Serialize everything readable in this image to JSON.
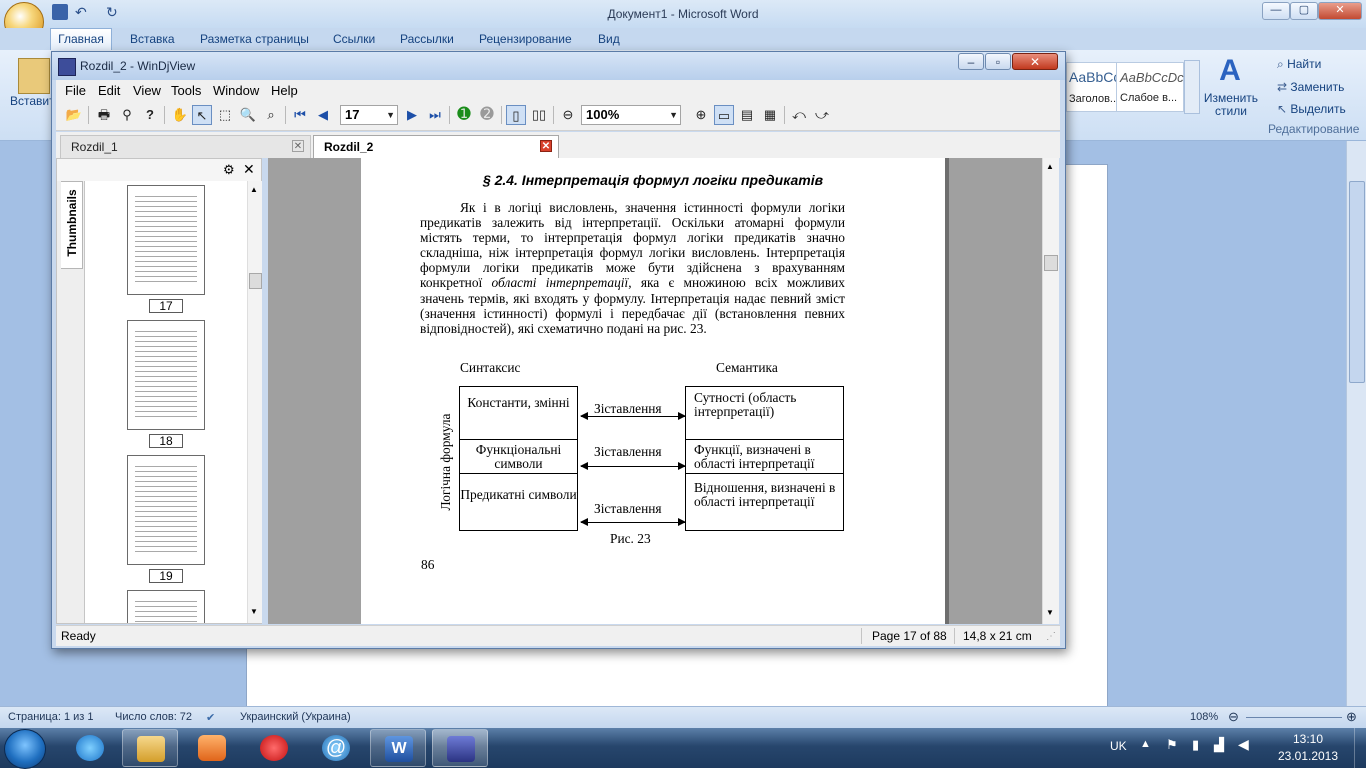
{
  "word": {
    "title": "Документ1 - Microsoft Word",
    "window_controls": [
      "—",
      "▢",
      "✕"
    ],
    "tabs": [
      "Главная",
      "Вставка",
      "Разметка страницы",
      "Ссылки",
      "Рассылки",
      "Рецензирование",
      "Вид"
    ],
    "ribbon": {
      "paste": "Вставит",
      "styles": [
        "AaBbCc.",
        "AaBbCcDc"
      ],
      "style_names": [
        "Заголов...",
        "Слабое в..."
      ],
      "change_styles": "Изменить стили",
      "find": "Найти",
      "replace": "Заменить",
      "select": "Выделить",
      "editing": "Редактирование"
    },
    "status": {
      "page": "Страница: 1 из 1",
      "words": "Число слов: 72",
      "language": "Украинский (Украина)",
      "zoom": "108%"
    }
  },
  "taskbar": {
    "language": "UK",
    "time": "13:10",
    "date": "23.01.2013"
  },
  "djvu": {
    "title": "Rozdil_2 - WinDjView",
    "menu": [
      "File",
      "Edit",
      "View",
      "Tools",
      "Window",
      "Help"
    ],
    "page_box": "17",
    "zoom_box": "100%",
    "tabs": [
      "Rozdil_1",
      "Rozdil_2"
    ],
    "sidebar_tab": "Thumbnails",
    "thumbnails": [
      "17",
      "18",
      "19"
    ],
    "status": {
      "left": "Ready",
      "page": "Page 17 of 88",
      "size": "14,8 x 21 cm"
    },
    "page": {
      "section_title": "§ 2.4. Інтерпретація формул логіки предикатів",
      "paragraph_before_italic": "Як і в логіці висловлень, значення істинності формули логіки предикатів залежить від інтерпретації. Оскільки атомарні формули містять терми, то інтерпретація формул логіки предикатів значно складніша, ніж інтерпретація формул логіки висловлень. Інтерпретація формули логіки предикатів може бути здійснена з врахуванням конкретної ",
      "paragraph_italic": "області інтерпретації",
      "paragraph_after_italic": ", яка є множиною всіх можливих значень термів, які входять у формулу. Інтерпретація надає певний зміст (значення істинності) формулі і передбачає дії (встановлення певних відповідностей), які схематично подані на рис. 23.",
      "figure": {
        "left_header": "Синтаксис",
        "right_header": "Семантика",
        "vertical_label": "Логічна формула",
        "left_cells": [
          "Константи, змінні",
          "Функціональні символи",
          "Предикатні символи"
        ],
        "arrow_label": "Зіставлення",
        "right_cells": [
          "Сутності (область інтерпретації)",
          "Функції, визначені в області інтерпретації",
          "Відношення, визначені в області інтерпретації"
        ],
        "caption": "Рис. 23"
      },
      "page_number": "86"
    }
  }
}
